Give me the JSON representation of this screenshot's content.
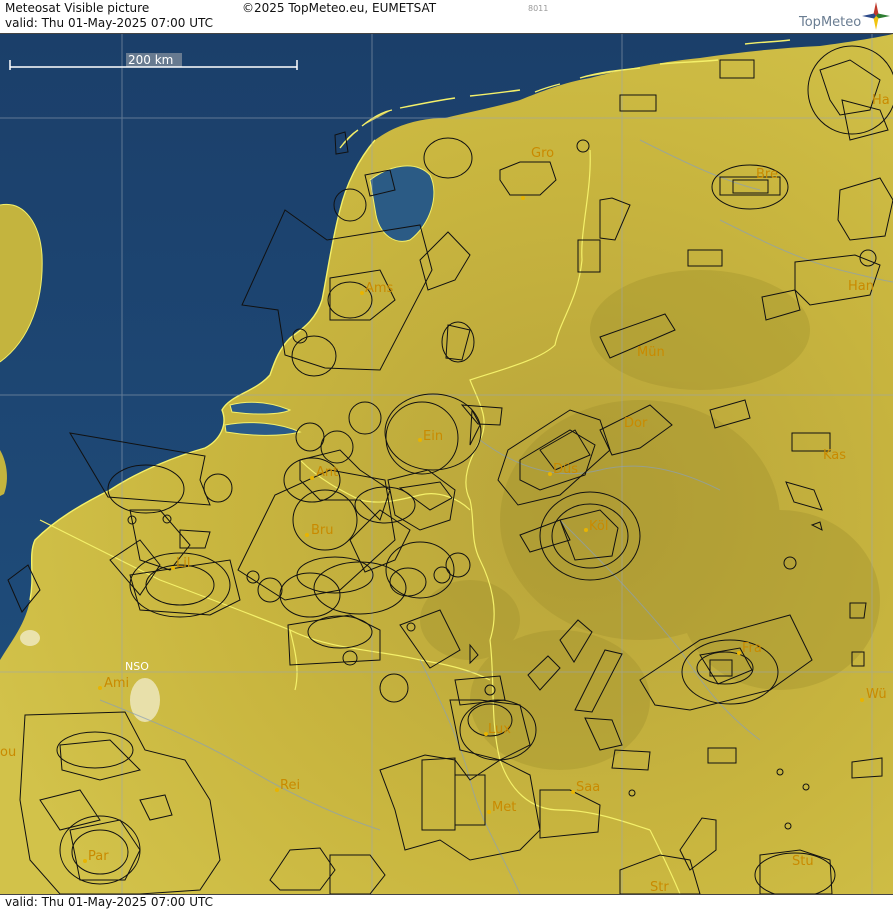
{
  "header": {
    "title": "Meteosat Visible picture",
    "valid": "valid:  Thu  01-May-2025  07:00 UTC",
    "copyright": "©2025 TopMeteo.eu, EUMETSAT",
    "code": "8011",
    "brand": "TopMeteo"
  },
  "footer": {
    "valid": "valid:  Thu  01-May-2025  07:00 UTC"
  },
  "scale": {
    "label": "200 km"
  },
  "colors": {
    "sea": "#1d4a7a",
    "land": "#c7b53a",
    "border": "#f4f06a",
    "airspace": "#111111",
    "city_label": "#c98a00"
  },
  "cities": [
    {
      "name": "Gro"
    },
    {
      "name": "Bre"
    },
    {
      "name": "Ha"
    },
    {
      "name": "Ams"
    },
    {
      "name": "Han"
    },
    {
      "name": "Mün"
    },
    {
      "name": "Ein"
    },
    {
      "name": "Dor"
    },
    {
      "name": "Ant"
    },
    {
      "name": "Düs"
    },
    {
      "name": "Kas"
    },
    {
      "name": "Bru"
    },
    {
      "name": "Köl"
    },
    {
      "name": "Lil"
    },
    {
      "name": "NSO"
    },
    {
      "name": "Ami"
    },
    {
      "name": "Fra"
    },
    {
      "name": "Wü"
    },
    {
      "name": "Lux"
    },
    {
      "name": "Rei"
    },
    {
      "name": "Saa"
    },
    {
      "name": "Met"
    },
    {
      "name": "Par"
    },
    {
      "name": "Stu"
    },
    {
      "name": "Str"
    },
    {
      "name": "ou"
    }
  ]
}
